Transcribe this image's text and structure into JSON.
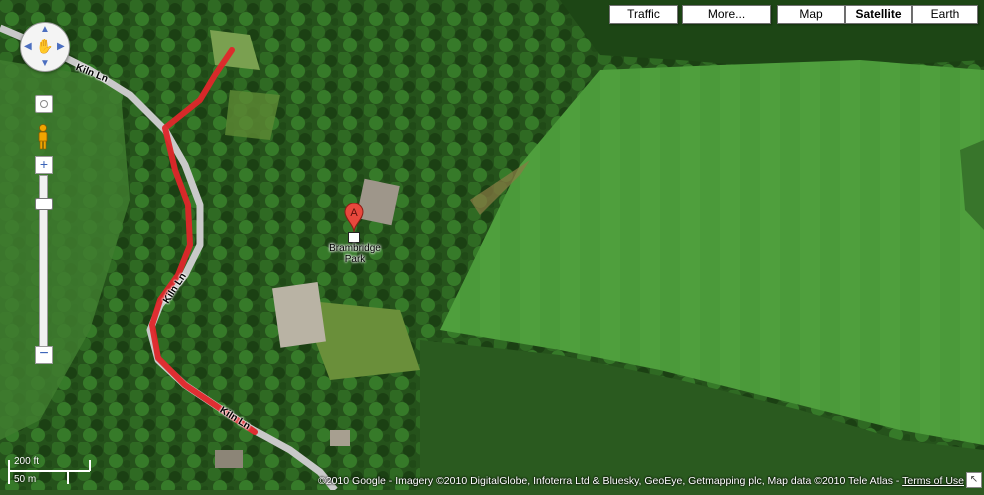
{
  "map_type_buttons": [
    {
      "label": "Traffic",
      "active": false
    },
    {
      "label": "More...",
      "active": false
    },
    {
      "label": "Map",
      "active": false
    },
    {
      "label": "Satellite",
      "active": true
    },
    {
      "label": "Earth",
      "active": false
    }
  ],
  "roads": {
    "road_label_1": "Kiln Ln",
    "road_label_2": "Kiln Ln",
    "road_label_3": "Kiln Ln"
  },
  "place": {
    "marker_letter": "A",
    "name_line1": "Brambridge",
    "name_line2": "Park"
  },
  "scale": {
    "imperial": "200 ft",
    "metric": "50 m"
  },
  "footer": {
    "copyright": "©2010 Google - Imagery ©2010 DigitalGlobe, Infoterra Ltd & Bluesky, GeoEye, Getmapping plc, Map data ©2010 Tele Atlas - ",
    "terms": "Terms of Use"
  },
  "colors": {
    "route": "#e0262a",
    "road": "#c9c9c9",
    "field": "#4d9a3b",
    "forest": "#1f4a17",
    "marker": "#e8483d"
  },
  "icons": [
    "pan-control-icon",
    "pegman-icon",
    "recenter-icon",
    "zoom-in-icon",
    "zoom-out-icon",
    "place-marker-icon",
    "resize-corner-icon"
  ]
}
